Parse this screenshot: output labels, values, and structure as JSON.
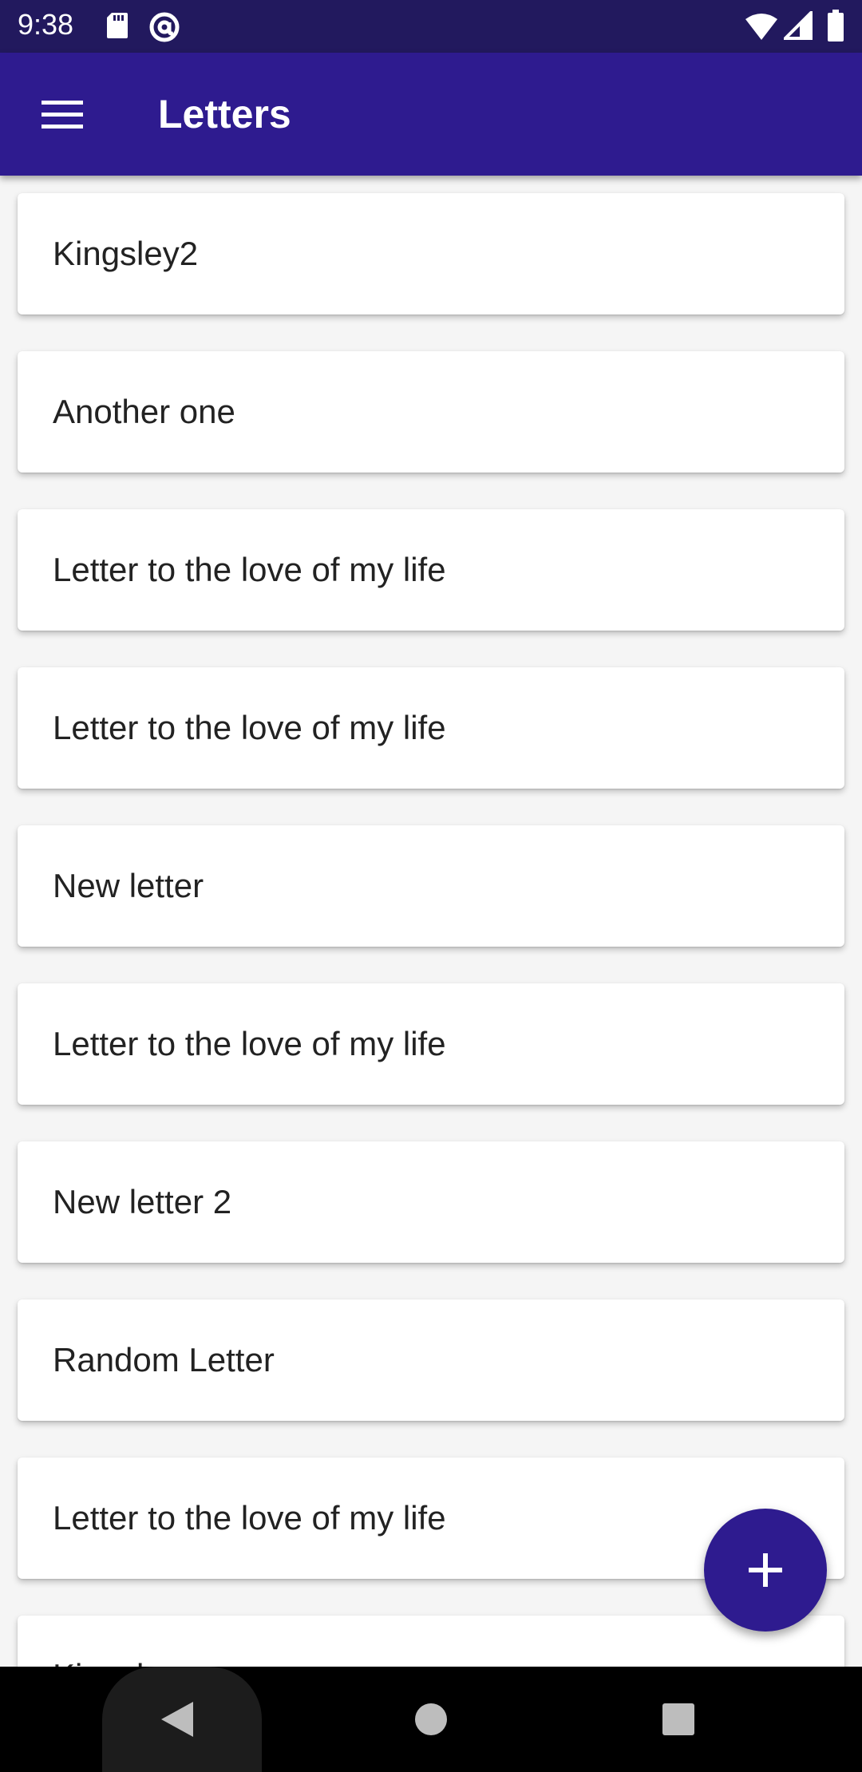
{
  "status_bar": {
    "time": "9:38",
    "icons": [
      "sd-card-icon",
      "at-sign-icon",
      "wifi-icon",
      "signal-icon",
      "battery-icon"
    ]
  },
  "app_bar": {
    "title": "Letters",
    "menu_icon": "hamburger-menu-icon",
    "background": "#2e1b8f"
  },
  "letters": [
    {
      "title": "Kingsley2"
    },
    {
      "title": "Another one"
    },
    {
      "title": "Letter to the love of my life"
    },
    {
      "title": "Letter to the love of my life"
    },
    {
      "title": "New letter"
    },
    {
      "title": "Letter to the love of my life"
    },
    {
      "title": "New letter 2"
    },
    {
      "title": "Random Letter"
    },
    {
      "title": "Letter to the love of my life"
    },
    {
      "title": "Kingsley"
    }
  ],
  "fab": {
    "icon": "plus-icon",
    "background": "#2e1b8f"
  },
  "nav_bar": {
    "icons": [
      "back-icon",
      "home-icon",
      "recents-icon"
    ]
  },
  "colors": {
    "status_bar": "#22195e",
    "accent": "#2e1b8f"
  }
}
